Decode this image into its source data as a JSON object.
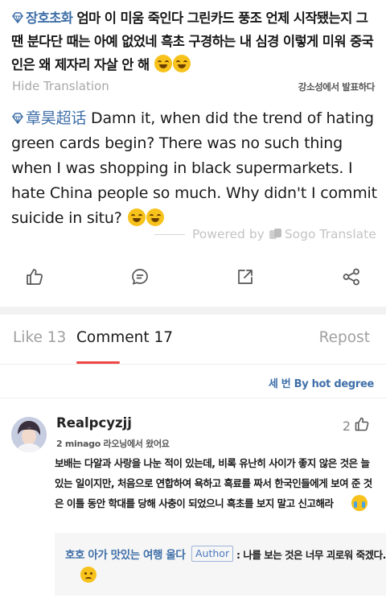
{
  "post": {
    "korean_topic": "장호초화",
    "korean_text": " 엄마 이 미움 죽인다 그린카드 풍조 언제 시작됐는지 그땐 분다단 때는 아예 없었네 흑초 구경하는 내 심경 이렇게 미워 중국인은 왜 제자리 자살 안 해",
    "hide_translation": "Hide Translation",
    "source_note": "강소성에서 발표하다",
    "english_topic": "章昊超话",
    "english_text": " Damn it, when did the trend of hating green cards begin? There was no such thing when I was shopping in black supermarkets. I hate China people so much. Why didn't I commit suicide in situ?",
    "powered_by": "Powered by",
    "translator": "Sogo Translate"
  },
  "icons": {
    "like": "thumbs-up-icon",
    "comment": "comment-bubble-icon",
    "share": "share-arrow-icon",
    "repost": "network-share-icon",
    "topic": "diamond-tag-icon",
    "emoji_grin": "grinning-emoji-icon",
    "emoji_cry": "crying-emoji-icon",
    "emoji_sad": "sad-emoji-icon"
  },
  "tabs": {
    "like": "Like 13",
    "comment": "Comment 17",
    "repost": "Repost"
  },
  "sort_label": "세 번 By hot degree",
  "comment": {
    "username": "Realpcyzjj",
    "meta": "2 minago 라오닝에서 왔어요",
    "like_count": "2",
    "body": "보배는 다알과 사랑을 나눈 적이 있는데, 비록 유난히 사이가 좋지 않은 것은 늘 있는 일이지만, 처음으로 연합하여 욕하고 흑료를 짜서 한국인들에게 보여 준 것은 이틀 동안 학대를 당해 사충이 되었으니 흑초를 보지 말고 신고해라",
    "reply": {
      "name": "호호 아가 맛있는 여행 울다",
      "badge": "Author",
      "text": ": 나를 보는 것은 너무 괴로워 죽겠다."
    }
  },
  "colors": {
    "link": "#3f6fa8",
    "tab_underline": "#ef4646",
    "muted": "#a0a0a0"
  }
}
